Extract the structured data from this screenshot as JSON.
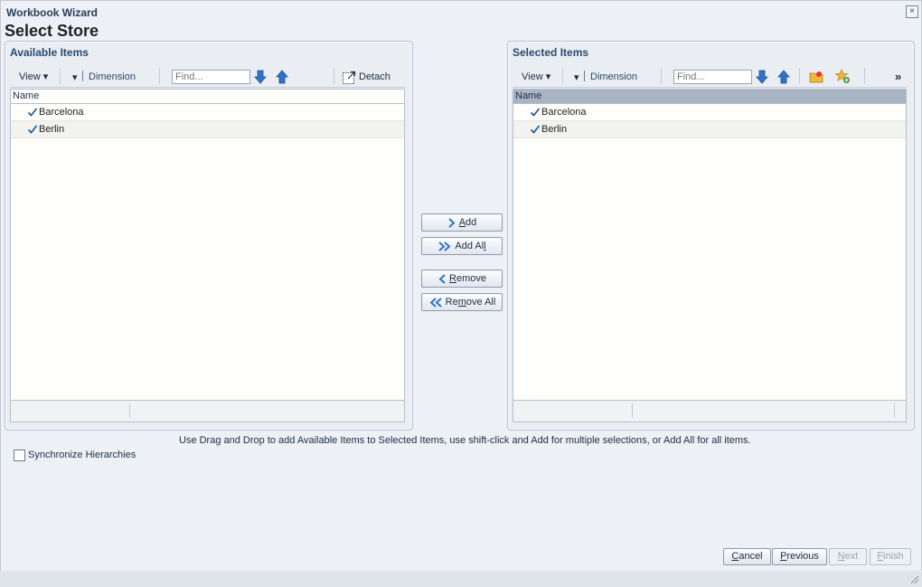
{
  "wizard": {
    "title": "Workbook Wizard",
    "page_title": "Select Store",
    "close_label": "×"
  },
  "available": {
    "title": "Available Items",
    "toolbar": {
      "view": "View ▾",
      "dimension_caret": "▾",
      "dimension": "Dimension",
      "find_placeholder": "Find...",
      "detach": "Detach"
    },
    "column": "Name",
    "rows": [
      "Barcelona",
      "Berlin"
    ]
  },
  "selected": {
    "title": "Selected Items",
    "toolbar": {
      "view": "View ▾",
      "dimension_caret": "▾",
      "dimension": "Dimension",
      "find_placeholder": "Find...",
      "more": "»"
    },
    "column": "Name",
    "rows": [
      "Barcelona",
      "Berlin"
    ]
  },
  "shuttle": {
    "add_underline": "A",
    "add_rest": "dd",
    "add_all_pre": "Add Al",
    "add_all_underline": "l",
    "remove_underline": "R",
    "remove_rest": "emove",
    "remove_all_pre": "Re",
    "remove_all_underline": "m",
    "remove_all_rest": "ove All"
  },
  "instructions": "Use Drag and Drop to add Available Items to Selected Items, use shift-click and Add for multiple selections, or Add All for all items.",
  "sync_hierarchies": "Synchronize Hierarchies",
  "footer": {
    "cancel_underline": "C",
    "cancel_rest": "ancel",
    "previous_underline": "P",
    "previous_rest": "revious",
    "next_underline": "N",
    "next_rest": "ext",
    "finish_underline": "F",
    "finish_rest": "inish"
  },
  "colors": {
    "arrow_blue": "#2f73c9",
    "check_blue": "#2a5d9a",
    "folder_yellow": "#f0b93a"
  }
}
